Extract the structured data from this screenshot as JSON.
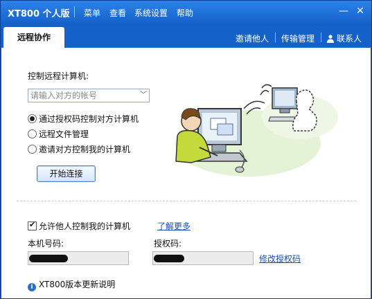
{
  "app": {
    "title": "XT800 个人版"
  },
  "menus": [
    "菜单",
    "查看",
    "系统设置",
    "帮助"
  ],
  "window_buttons": {
    "minimize": "—",
    "close": "✕"
  },
  "tabs": [
    {
      "label": "远程协作",
      "active": true
    }
  ],
  "toplinks": {
    "invite": "邀请他人",
    "transfer": "传输管理",
    "contacts": "联系人"
  },
  "remote": {
    "heading": "控制远程计算机:",
    "input_placeholder": "请输入对方的帐号",
    "options": [
      {
        "label": "通过授权码控制对方计算机",
        "checked": true
      },
      {
        "label": "远程文件管理",
        "checked": false
      },
      {
        "label": "邀请对方控制我的计算机",
        "checked": false
      }
    ],
    "connect_button": "开始连接"
  },
  "local": {
    "allow_control_label": "允许他人控制我的计算机",
    "allow_control_checked": true,
    "learn_more": "了解更多",
    "machine_code_label": "本机号码:",
    "auth_code_label": "授权码:",
    "change_auth_code": "修改授权码"
  },
  "footer": {
    "update_notes": "XT800版本更新说明"
  },
  "colors": {
    "titlebar": "#1763cc",
    "accent_link": "#1a4eb5",
    "button_border": "#4a7fc4"
  },
  "icons": [
    "user-icon",
    "dropdown-chevron-icon",
    "info-icon",
    "checkbox-icon",
    "radio-icon"
  ]
}
